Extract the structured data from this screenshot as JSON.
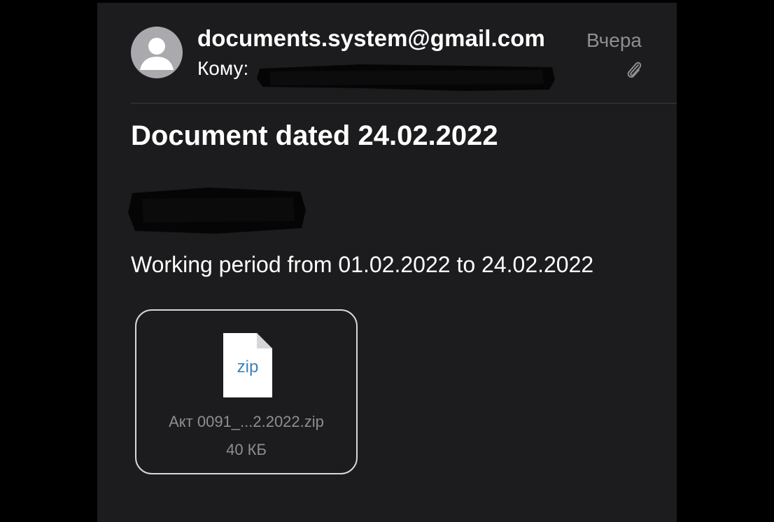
{
  "email": {
    "sender": "documents.system@gmail.com",
    "to_label": "Кому:",
    "received": "Вчера",
    "subject": "Document dated 24.02.2022",
    "body": "Working period from 01.02.2022 to 24.02.2022",
    "attachment": {
      "type_label": "zip",
      "file_name": "Акт 0091_...2.2022.zip",
      "file_size": "40 КБ"
    }
  },
  "icons": {
    "avatar": "person-avatar-icon",
    "attachment_indicator": "paperclip-icon",
    "file": "zip-file-icon"
  },
  "colors": {
    "background": "#000000",
    "panel": "#1c1c1e",
    "primary_text": "#ffffff",
    "secondary_text": "#8e8e93",
    "zip_label": "#3d83b8"
  }
}
